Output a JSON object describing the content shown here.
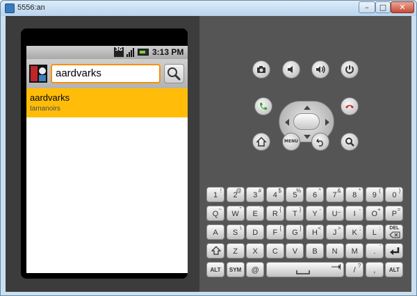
{
  "window": {
    "title": "5556:an",
    "min": "–",
    "max": "□",
    "close": "✕"
  },
  "status": {
    "network": "3G",
    "time": "3:13 PM"
  },
  "search": {
    "query": "aardvarks"
  },
  "suggestion": {
    "title": "aardvarks",
    "subtitle": "tamanoirs"
  },
  "controls": {
    "menu_label": "MENU"
  },
  "keyboard": {
    "row1": [
      [
        "1",
        "!"
      ],
      [
        "2",
        "@"
      ],
      [
        "3",
        "#"
      ],
      [
        "4",
        "$"
      ],
      [
        "5",
        "%"
      ],
      [
        "6",
        "^"
      ],
      [
        "7",
        "&"
      ],
      [
        "8",
        "*"
      ],
      [
        "9",
        "("
      ],
      [
        "0",
        ")"
      ]
    ],
    "row2": [
      [
        "Q",
        "~"
      ],
      [
        "W",
        "\""
      ],
      [
        "E",
        "`"
      ],
      [
        "R",
        "{"
      ],
      [
        "T",
        "}"
      ],
      [
        "Y",
        "-"
      ],
      [
        "U",
        "_"
      ],
      [
        "I",
        "-"
      ],
      [
        "O",
        "+"
      ],
      [
        "P",
        "="
      ]
    ],
    "row3": [
      [
        "A",
        ""
      ],
      [
        "S",
        "\\"
      ],
      [
        "D",
        ""
      ],
      [
        "F",
        "["
      ],
      [
        "G",
        "]"
      ],
      [
        "H",
        "<"
      ],
      [
        "J",
        ">"
      ],
      [
        "K",
        ";"
      ],
      [
        "L",
        ":"
      ],
      [
        "DEL",
        ""
      ]
    ],
    "row4": [
      [
        "Z",
        ""
      ],
      [
        "X",
        ""
      ],
      [
        "C",
        ""
      ],
      [
        "V",
        ""
      ],
      [
        "B",
        ""
      ],
      [
        "N",
        ""
      ],
      [
        "M",
        ""
      ],
      [
        ".",
        "'"
      ]
    ],
    "row5": [
      [
        "ALT",
        ""
      ],
      [
        "SYM",
        ""
      ],
      [
        "@",
        ""
      ],
      [
        "/",
        "?"
      ],
      [
        ",",
        ""
      ],
      [
        "ALT",
        ""
      ]
    ]
  },
  "colors": {
    "highlight": "#ffbd0a",
    "focus": "#ff8f00",
    "call": "#2fa32f",
    "end": "#cc2222"
  }
}
